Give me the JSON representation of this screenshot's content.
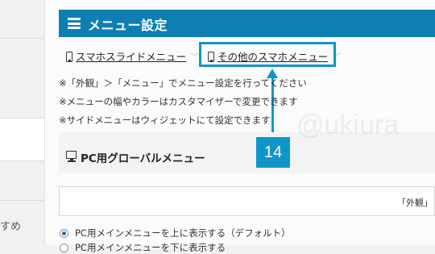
{
  "sidebar": {
    "partial_label": "すめ"
  },
  "header": {
    "title": "メニュー設定"
  },
  "tabs": [
    {
      "label": "スマホスライドメニュー"
    },
    {
      "label": "その他のスマホメニュー"
    }
  ],
  "notes": [
    "※「外観」＞「メニュー」でメニュー設定を行ってください",
    "※メニューの幅やカラーはカスタマイザーで変更できます",
    "※サイドメニューはウィジェットにて設定できます"
  ],
  "annotation": {
    "number": "14"
  },
  "watermark": "@ukiura",
  "section": {
    "title": "PC用グローバルメニュー"
  },
  "input": {
    "value_visible": "「外観」"
  },
  "radios": [
    {
      "label": "PC用メインメニューを上に表示する（デフォルト）",
      "checked": true
    },
    {
      "label": "PC用メインメニューを下に表示する",
      "checked": false
    }
  ],
  "colors": {
    "header_bg": "#0e7fb3",
    "accent": "#0f96c8"
  }
}
